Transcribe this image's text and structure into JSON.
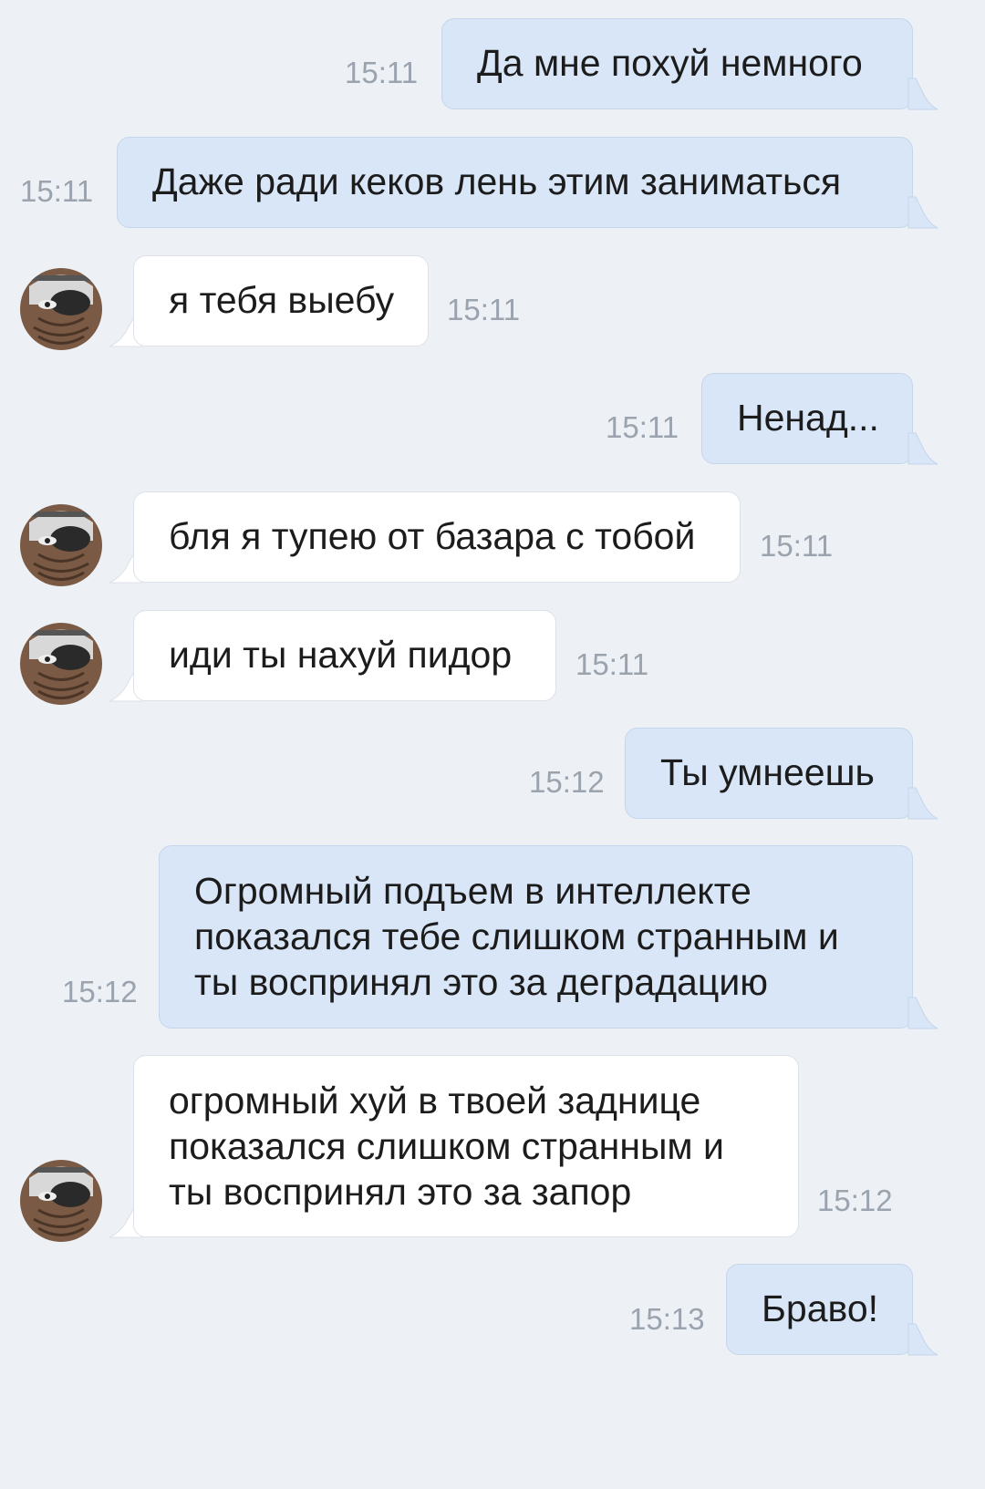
{
  "messages": [
    {
      "direction": "out",
      "text": "Да мне похуй немного",
      "time": "15:11"
    },
    {
      "direction": "out",
      "text": "Даже ради кеков лень этим заниматься",
      "time": "15:11"
    },
    {
      "direction": "in",
      "text": "я тебя выебу",
      "time": "15:11",
      "avatar": "user-avatar"
    },
    {
      "direction": "out",
      "text": "Ненад...",
      "time": "15:11"
    },
    {
      "direction": "in",
      "text": "бля я тупею от базара с тобой",
      "time": "15:11",
      "avatar": "user-avatar"
    },
    {
      "direction": "in",
      "text": "иди ты нахуй пидор",
      "time": "15:11",
      "avatar": "user-avatar"
    },
    {
      "direction": "out",
      "text": "Ты умнеешь",
      "time": "15:12"
    },
    {
      "direction": "out",
      "lines": [
        "Огромный подъем в интеллекте",
        "показался тебе слишком странным и",
        "ты воспринял это за деградацию"
      ],
      "time": "15:12"
    },
    {
      "direction": "in",
      "lines": [
        "огромный хуй в твоей заднице",
        "показался слишком странным и",
        "ты воспринял это за запор"
      ],
      "time": "15:12",
      "avatar": "user-avatar"
    },
    {
      "direction": "out",
      "text": "Браво!",
      "time": "15:13"
    }
  ],
  "colors": {
    "background": "#edf0f5",
    "outgoing_bubble": "#d9e6f7",
    "incoming_bubble": "#ffffff",
    "time_text": "#9aa3ae",
    "message_text": "#1c1c1c"
  }
}
